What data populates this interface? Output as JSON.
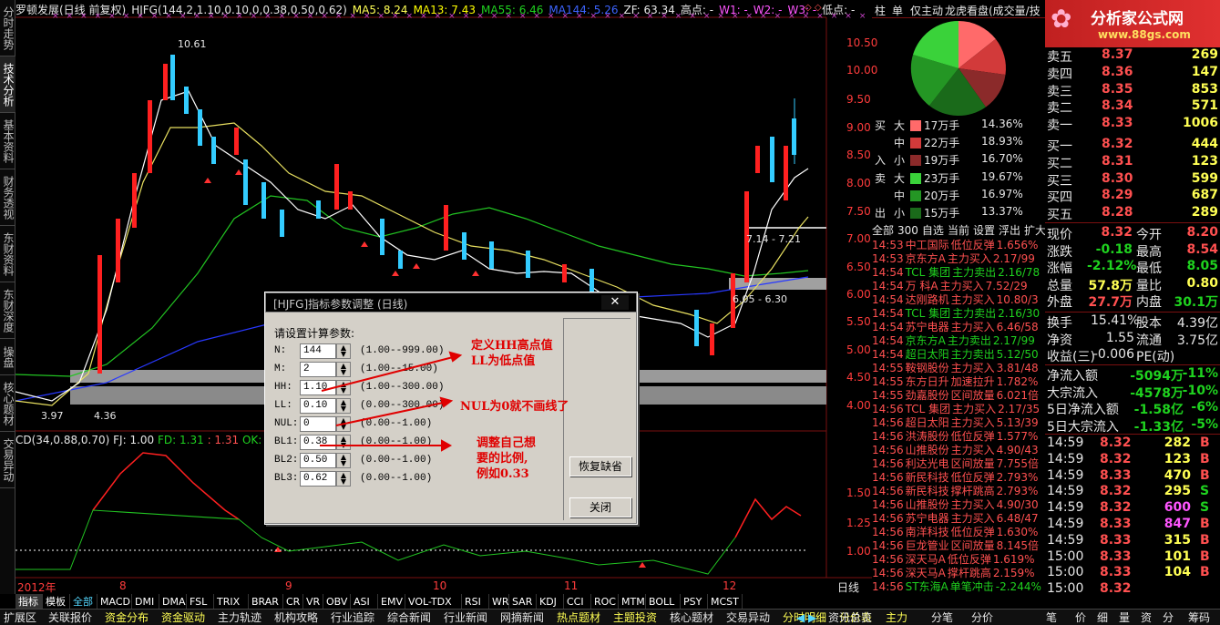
{
  "left_tabs": [
    "分时走势",
    "技术分析",
    "基本资料",
    "财务透视",
    "东财资料",
    "东财深度",
    "操盘手",
    "核心题材",
    "交易异动"
  ],
  "header": {
    "stock": "罗顿发展(日线 前复权)",
    "indicator": "HJFG(144,2,1.10,0.10,0,0.38,0.50,0.62)",
    "ma5": "MA5: 8.24",
    "ma13": "MA13: 7.43",
    "ma55": "MA55: 6.46",
    "ma144": "MA144: 5.26",
    "zf": "ZF: 63.34",
    "high": "高点: -",
    "w1": "W1: -",
    "w2": "W2: -",
    "w3": "W3: -",
    "low": "低点: -"
  },
  "price_axis": [
    "10.50",
    "10.00",
    "9.50",
    "9.00",
    "8.50",
    "8.00",
    "7.50",
    "7.00",
    "6.50",
    "6.00",
    "5.50",
    "5.00",
    "4.50",
    "4.00"
  ],
  "lower_axis": [
    "1.50",
    "1.25",
    "1.00"
  ],
  "chart_notes": {
    "high_label": "10.61",
    "low_label_a": "3.97",
    "low_label_b": "4.36",
    "band1": "7.14 - 7.21",
    "band2": "6.05 - 6.30",
    "dotted_low": "3.79"
  },
  "lower_header": {
    "cd": "CD(34,0.88,0.70)",
    "fj": "FJ: 1.00",
    "fd": "FD: 1.31",
    "x": ": 1.31",
    "ok": "OK: 0.0"
  },
  "date_axis": [
    "2012年",
    "8",
    "9",
    "10",
    "11",
    "12"
  ],
  "period": "日线",
  "dialog": {
    "title": "[HJFG]指标参数调整 (日线)",
    "close": "✕",
    "prompt": "请设置计算参数:",
    "params": [
      {
        "name": "N:",
        "value": "144",
        "range": "(1.00--999.00)"
      },
      {
        "name": "M:",
        "value": "2",
        "range": "(1.00--15.00)"
      },
      {
        "name": "HH:",
        "value": "1.10",
        "range": "(1.00--300.00)"
      },
      {
        "name": "LL:",
        "value": "0.10",
        "range": "(0.00--300.00)"
      },
      {
        "name": "NUL:",
        "value": "0",
        "range": "(0.00--1.00)"
      },
      {
        "name": "BL1:",
        "value": "0.38",
        "range": "(0.00--1.00)"
      },
      {
        "name": "BL2:",
        "value": "0.50",
        "range": "(0.00--1.00)"
      },
      {
        "name": "BL3:",
        "value": "0.62",
        "range": "(0.00--1.00)"
      }
    ],
    "restore": "恢复缺省",
    "close_btn": "关闭",
    "note1a": "定义HH高点值",
    "note1b": "LL为低点值",
    "note2": "NUL为0就不画线了",
    "note3a": "调整自己想",
    "note3b": "要的比例,",
    "note3c": "例如0.33"
  },
  "bottom_tabs": [
    "指标",
    "模板",
    "全部",
    "MACD",
    "DMI",
    "DMA",
    "FSL",
    "TRIX",
    "BRAR",
    "CR",
    "VR",
    "OBV",
    "ASI",
    "EMV",
    "VOL-TDX",
    "RSI",
    "WR",
    "SAR",
    "KDJ",
    "CCI",
    "ROC",
    "MTM",
    "BOLL",
    "PSY",
    "MCST"
  ],
  "status_tabs": [
    "扩展区",
    "关联报价",
    "资金分布",
    "资金驱动",
    "主力轨迹",
    "机构攻略",
    "行业追踪",
    "综合新闻",
    "行业新闻",
    "网摘新闻",
    "热点题材",
    "主题投资",
    "核心题材",
    "交易异动",
    "分时明细",
    "分价表"
  ],
  "status_right": [
    "资讯总览",
    "主力",
    "分笔",
    "分价",
    "笔",
    "价",
    "细",
    "量",
    "资",
    "分",
    "筹码"
  ],
  "right": {
    "tabs": [
      "柱",
      "单",
      "仅主动",
      "龙虎看盘(成交量/技"
    ],
    "logo": "分析家公式网",
    "logo_url": "www.88gs.com",
    "flow": [
      {
        "side": "买",
        "size": "大",
        "amt": "17万手",
        "pct": "14.36%",
        "color": "#ff6a6a"
      },
      {
        "side": "",
        "size": "中",
        "amt": "22万手",
        "pct": "18.93%",
        "color": "#d23a3a"
      },
      {
        "side": "入",
        "size": "小",
        "amt": "19万手",
        "pct": "16.70%",
        "color": "#8b2a2a"
      },
      {
        "side": "卖",
        "size": "大",
        "amt": "23万手",
        "pct": "19.67%",
        "color": "#3ad23a"
      },
      {
        "side": "",
        "size": "中",
        "amt": "20万手",
        "pct": "16.97%",
        "color": "#249624"
      },
      {
        "side": "出",
        "size": "小",
        "amt": "15万手",
        "pct": "13.37%",
        "color": "#1a6a1a"
      }
    ],
    "alert_tabs": [
      "全部",
      "300",
      "自选",
      "当前",
      "设置",
      "浮出",
      "扩大"
    ],
    "alerts": [
      [
        "14:53",
        "中工国际",
        "低位反弹",
        "1.656%",
        "red"
      ],
      [
        "14:53",
        "京东方A",
        "主力买入",
        "2.17/99",
        "red"
      ],
      [
        "14:54",
        "TCL 集团",
        "主力卖出",
        "2.16/78",
        "grn"
      ],
      [
        "14:54",
        "万 科A",
        "主力买入",
        "7.52/29",
        "red"
      ],
      [
        "14:54",
        "达刚路机",
        "主力买入",
        "10.80/3",
        "red"
      ],
      [
        "14:54",
        "TCL 集团",
        "主力卖出",
        "2.16/30",
        "grn"
      ],
      [
        "14:54",
        "苏宁电器",
        "主力买入",
        "6.46/58",
        "red"
      ],
      [
        "14:54",
        "京东方A",
        "主力卖出",
        "2.17/99",
        "grn"
      ],
      [
        "14:54",
        "超日太阳",
        "主力卖出",
        "5.12/50",
        "grn"
      ],
      [
        "14:55",
        "鞍钢股份",
        "主力买入",
        "3.81/48",
        "red"
      ],
      [
        "14:55",
        "东方日升",
        "加速拉升",
        "1.782%",
        "red"
      ],
      [
        "14:55",
        "劲嘉股份",
        "区间放量",
        "6.021倍",
        "red"
      ],
      [
        "14:56",
        "TCL 集团",
        "主力买入",
        "2.17/35",
        "red"
      ],
      [
        "14:56",
        "超日太阳",
        "主力买入",
        "5.13/39",
        "red"
      ],
      [
        "14:56",
        "洪涛股份",
        "低位反弹",
        "1.577%",
        "red"
      ],
      [
        "14:56",
        "山推股份",
        "主力买入",
        "4.90/43",
        "red"
      ],
      [
        "14:56",
        "利达光电",
        "区间放量",
        "7.755倍",
        "red"
      ],
      [
        "14:56",
        "新民科技",
        "低位反弹",
        "2.793%",
        "red"
      ],
      [
        "14:56",
        "新民科技",
        "撑杆跳高",
        "2.793%",
        "red"
      ],
      [
        "14:56",
        "山推股份",
        "主力买入",
        "4.90/30",
        "red"
      ],
      [
        "14:56",
        "苏宁电器",
        "主力买入",
        "6.48/47",
        "red"
      ],
      [
        "14:56",
        "南洋科技",
        "低位反弹",
        "1.630%",
        "red"
      ],
      [
        "14:56",
        "巨龙管业",
        "区间放量",
        "8.145倍",
        "red"
      ],
      [
        "14:56",
        "深天马A",
        "低位反弹",
        "1.619%",
        "red"
      ],
      [
        "14:56",
        "深天马A",
        "撑杆跳高",
        "2.159%",
        "red"
      ],
      [
        "14:56",
        "ST东海A",
        "单笔冲击",
        "-2.244%",
        "grn"
      ]
    ],
    "book": [
      [
        "卖五",
        "8.37",
        "269"
      ],
      [
        "卖四",
        "8.36",
        "147"
      ],
      [
        "卖三",
        "8.35",
        "853"
      ],
      [
        "卖二",
        "8.34",
        "571"
      ],
      [
        "卖一",
        "8.33",
        "1006"
      ],
      [
        "买一",
        "8.32",
        "444"
      ],
      [
        "买二",
        "8.31",
        "123"
      ],
      [
        "买三",
        "8.30",
        "599"
      ],
      [
        "买四",
        "8.29",
        "687"
      ],
      [
        "买五",
        "8.28",
        "289"
      ]
    ],
    "quote": [
      [
        "现价",
        "8.32",
        "今开",
        "8.20"
      ],
      [
        "涨跌",
        "-0.18",
        "最高",
        "8.54"
      ],
      [
        "涨幅",
        "-2.12%",
        "最低",
        "8.05"
      ],
      [
        "总量",
        "57.8万",
        "量比",
        "0.80"
      ],
      [
        "外盘",
        "27.7万",
        "内盘",
        "30.1万"
      ]
    ],
    "quote2": [
      [
        "换手",
        "15.41%",
        "股本",
        "4.39亿"
      ],
      [
        "净资",
        "1.55",
        "流通",
        "3.75亿"
      ],
      [
        "收益(三)",
        "-0.006",
        "PE(动)",
        ""
      ]
    ],
    "netflow": [
      [
        "净流入额",
        "-5094万",
        "-11%"
      ],
      [
        "大宗流入",
        "-4578万",
        "-10%"
      ],
      [
        "5日净流入额",
        "-1.58亿",
        "-6%"
      ],
      [
        "5日大宗流入",
        "-1.33亿",
        "-5%"
      ]
    ],
    "ticks": [
      [
        "14:59",
        "8.32",
        "282",
        "B"
      ],
      [
        "14:59",
        "8.32",
        "123",
        "B"
      ],
      [
        "14:59",
        "8.33",
        "470",
        "B"
      ],
      [
        "14:59",
        "8.32",
        "295",
        "S"
      ],
      [
        "14:59",
        "8.32",
        "600",
        "S"
      ],
      [
        "14:59",
        "8.33",
        "847",
        "B"
      ],
      [
        "14:59",
        "8.33",
        "315",
        "B"
      ],
      [
        "15:00",
        "8.33",
        "101",
        "B"
      ],
      [
        "15:00",
        "8.33",
        "104",
        "B"
      ],
      [
        "15:00",
        "8.32",
        "",
        ""
      ]
    ]
  }
}
